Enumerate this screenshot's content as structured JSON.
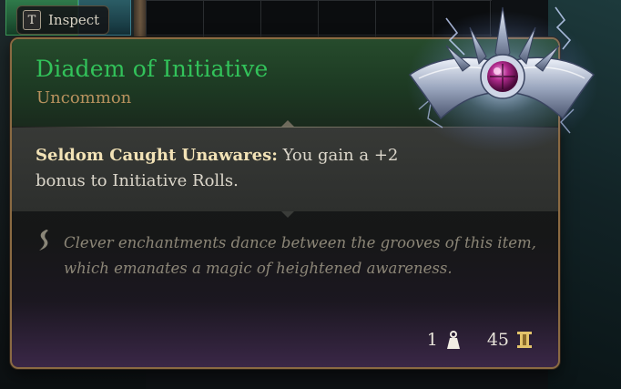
{
  "inspect_hint": {
    "key": "T",
    "label": "Inspect"
  },
  "item": {
    "name": "Diadem of Initiative",
    "rarity": "Uncommon",
    "property": {
      "name": "Seldom Caught Unawares:",
      "description": " You gain a +2 bonus to Initiative Rolls."
    },
    "flavor_text": "Clever enchantments dance between the grooves of this item, which emanates a magic of heightened awareness.",
    "weight": "1",
    "value": "45",
    "icons": {
      "item_art": "diadem-image",
      "flavor": "quill-icon",
      "weight": "weight-icon",
      "value": "gold-icon"
    }
  },
  "colors": {
    "title": "#32c25a",
    "rarity": "#b8925e",
    "property_name": "#f2e2b6",
    "border": "#8a6a42"
  }
}
